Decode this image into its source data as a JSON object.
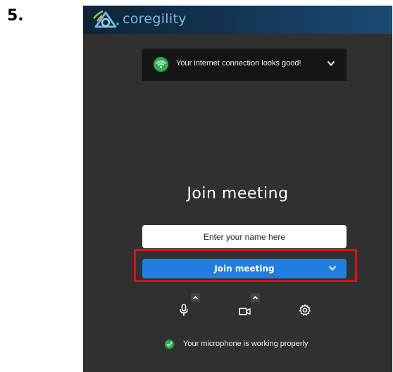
{
  "step": {
    "label": "5."
  },
  "header": {
    "brand": "coregility"
  },
  "connection_banner": {
    "text": "Your internet connection looks good!",
    "icon": "wifi-icon"
  },
  "main": {
    "title": "Join meeting",
    "name_input": {
      "placeholder": "Enter your name here",
      "value": ""
    },
    "join_button": {
      "label": "Join meeting"
    }
  },
  "controls": [
    "microphone-icon",
    "camera-icon",
    "settings-icon"
  ],
  "mic_status": {
    "text": "Your microphone is working properly"
  },
  "colors": {
    "accent": "#1f7ee0",
    "success": "#27b24a",
    "highlight": "#e01010",
    "panel": "#303030"
  }
}
